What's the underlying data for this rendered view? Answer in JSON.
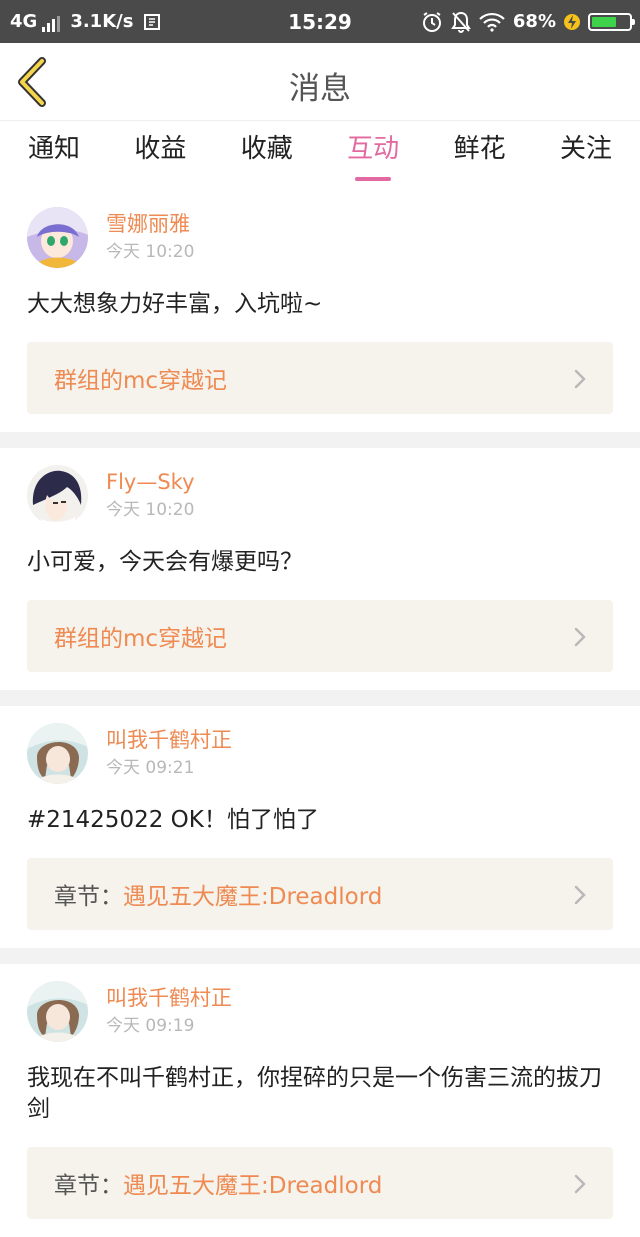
{
  "status_bar": {
    "network": "4G",
    "speed": "3.1K/s",
    "time": "15:29",
    "battery": "68%",
    "battery_level": 0.68
  },
  "header": {
    "title": "消息"
  },
  "tabs": [
    {
      "label": "通知",
      "active": false
    },
    {
      "label": "收益",
      "active": false
    },
    {
      "label": "收藏",
      "active": false
    },
    {
      "label": "互动",
      "active": true
    },
    {
      "label": "鲜花",
      "active": false
    },
    {
      "label": "关注",
      "active": false
    }
  ],
  "messages": [
    {
      "user": "雪娜丽雅",
      "time": "今天 10:20",
      "content": "大大想象力好丰富，入坑啦~",
      "ref_label": "",
      "ref_title": "群组的mc穿越记"
    },
    {
      "user": "Fly—Sky",
      "time": "今天 10:20",
      "content": "小可爱，今天会有爆更吗？",
      "ref_label": "",
      "ref_title": "群组的mc穿越记"
    },
    {
      "user": "叫我千鹤村正",
      "time": "今天 09:21",
      "content": "#21425022 OK！怕了怕了",
      "ref_label": "章节：",
      "ref_title": "遇见五大魔王:Dreadlord"
    },
    {
      "user": "叫我千鹤村正",
      "time": "今天 09:19",
      "content": "我现在不叫千鹤村正，你捏碎的只是一个伤害三流的拔刀剑",
      "ref_label": "章节：",
      "ref_title": "遇见五大魔王:Dreadlord"
    }
  ]
}
